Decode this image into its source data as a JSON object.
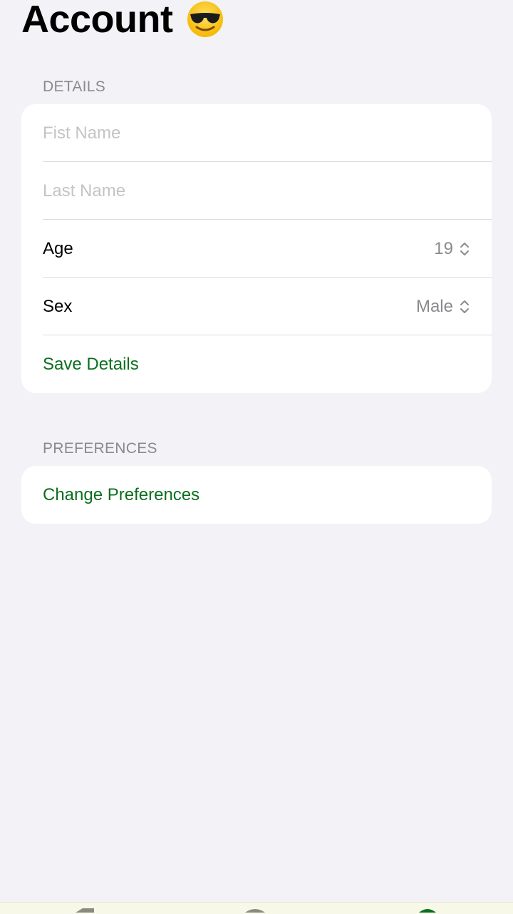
{
  "header": {
    "title": "Account",
    "emoji_icon": "sunglasses-face-icon"
  },
  "details": {
    "section_label": "DETAILS",
    "first_name": {
      "value": "",
      "placeholder": "Fist Name"
    },
    "last_name": {
      "value": "",
      "placeholder": "Last Name"
    },
    "age": {
      "label": "Age",
      "value": "19"
    },
    "sex": {
      "label": "Sex",
      "value": "Male"
    },
    "save_label": "Save Details"
  },
  "preferences": {
    "section_label": "PREFERENCES",
    "change_label": "Change Preferences"
  },
  "colors": {
    "background": "#f2f2f7",
    "card": "#ffffff",
    "accent_green": "#0b6e1e",
    "secondary_text": "#8a8a8e",
    "placeholder": "#c4c4c7"
  }
}
